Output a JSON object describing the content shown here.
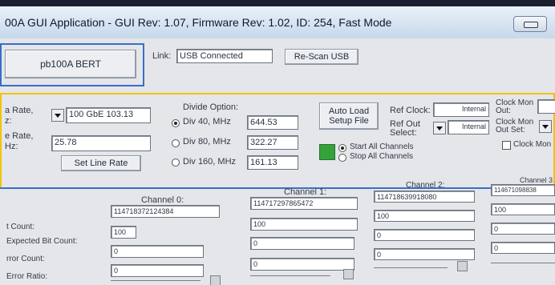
{
  "window": {
    "title": "00A GUI Application - GUI Rev: 1.07, Firmware Rev: 1.02, ID: 254, Fast Mode"
  },
  "top_bar": {
    "device_button": "pb100A BERT",
    "link_label": "Link:",
    "link_value": "USB Connected",
    "rescan_button": "Re-Scan USB"
  },
  "rate": {
    "data_rate_label_1": "a Rate,",
    "data_rate_label_2": "z:",
    "data_rate_value": "100 GbE 103.13",
    "line_rate_label_1": "e Rate,",
    "line_rate_label_2": "Hz:",
    "line_rate_value": "25.78",
    "set_line_rate_button": "Set Line Rate"
  },
  "divide": {
    "label": "Divide Option:",
    "options": [
      {
        "label": "Div 40, MHz",
        "value": "644.53",
        "selected": true
      },
      {
        "label": "Div 80, MHz",
        "value": "322.27",
        "selected": false
      },
      {
        "label": "Div 160, MHz",
        "value": "161.13",
        "selected": false
      }
    ]
  },
  "setup": {
    "auto_load_button": "Auto Load Setup File",
    "start_all": "Start All Channels",
    "stop_all": "Stop All Channels",
    "status_color": "#33a33a"
  },
  "ref_clock": {
    "label": "Ref Clock:",
    "value": "Internal",
    "out_select_label_1": "Ref Out",
    "out_select_label_2": "Select:",
    "out_select_value": "Internal"
  },
  "clock_mon": {
    "out_label_1": "Clock Mon",
    "out_label_2": "Out:",
    "set_label_1": "Clock Mon",
    "set_label_2": "Out Set:",
    "checkbox_label": "Clock Mon"
  },
  "rows": {
    "bit_count": "t Count:",
    "expected_bit_count": "Expected Bit Count:",
    "error_count": "rror Count:",
    "error_ratio": "Error Ratio:"
  },
  "channels": [
    {
      "name": "Channel 0:",
      "bit_count": "114718372124384",
      "expected": "100",
      "error_count": "0",
      "error_ratio": "0"
    },
    {
      "name": "Channel 1:",
      "bit_count": "114717297865472",
      "expected": "100",
      "error_count": "0",
      "error_ratio": "0"
    },
    {
      "name": "Channel 2:",
      "bit_count": "114718639918080",
      "expected": "100",
      "error_count": "0",
      "error_ratio": "0"
    },
    {
      "name": "Channel 3",
      "bit_count": "114671098838",
      "expected": "100",
      "error_count": "0",
      "error_ratio": "0"
    }
  ]
}
